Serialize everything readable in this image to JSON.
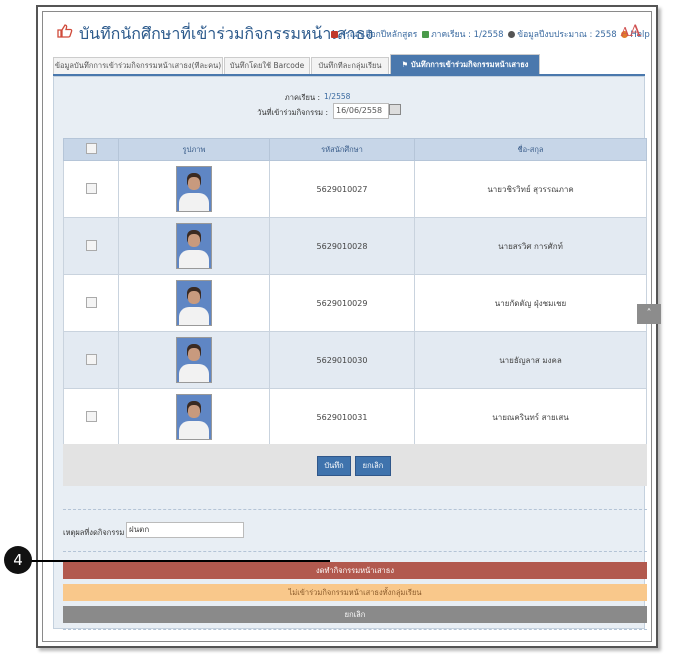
{
  "header": {
    "title": "บันทึกนักศึกษาที่เข้าร่วมกิจกรรมหน้าเสาธง",
    "select_curriculum": "กรุณาเลือกปีหลักสูตร",
    "semester_label": "ภาคเรียน : ",
    "semester_value": "1/2558",
    "budget_label": "ข้อมูลปีงบประมาณ : ",
    "budget_value": "2558",
    "help": "Help",
    "font_small": "A",
    "font_large": "A"
  },
  "tabs": [
    {
      "label": "ข้อมูลบันทึกการเข้าร่วมกิจกรรมหน้าเสาธง(ทีละคน)"
    },
    {
      "label": "บันทึกโดยใช้ Barcode"
    },
    {
      "label": "บันทึกทีละกลุ่มเรียน"
    },
    {
      "label": "บันทึกการเข้าร่วมกิจกรรมหน้าเสาธง"
    }
  ],
  "form": {
    "semester_label": "ภาคเรียน :",
    "semester_value": "1/2558",
    "date_label": "วันที่เข้าร่วมกิจกรรม :",
    "date_value": "16/06/2558"
  },
  "table": {
    "columns": [
      "",
      "รูปภาพ",
      "รหัสนักศึกษา",
      "ชื่อ-สกุล"
    ],
    "rows": [
      {
        "student_id": "5629010027",
        "name": "นายวชิรวิทย์ สุวรรณภาค"
      },
      {
        "student_id": "5629010028",
        "name": "นายสรวิศ การศักท์"
      },
      {
        "student_id": "5629010029",
        "name": "นายกัดตัญ ฝุ่งชมเชย"
      },
      {
        "student_id": "5629010030",
        "name": "นายธัญลาส มงคล"
      },
      {
        "student_id": "5629010031",
        "name": "นายณครินทร์ สายเสน"
      }
    ]
  },
  "buttons": {
    "save": "บันทึก",
    "cancel": "ยกเลิก"
  },
  "reason": {
    "label": "เหตุผลที่งดกิจกรรม",
    "value": "ฝนตก"
  },
  "bars": {
    "suspend": "งดทำกิจกรรมหน้าเสาธง",
    "not_join": "ไม่เข้าร่วมกิจกรรมหน้าเสาธงทั้งกลุ่มเรียน",
    "cancel": "ยกเลิก"
  },
  "callout": "4",
  "colors": {
    "accent": "#4a78ad",
    "suspend_bar": "#b2594e",
    "notjoin_bar": "#f9c88b",
    "cancel_bar": "#8a8a8a"
  }
}
